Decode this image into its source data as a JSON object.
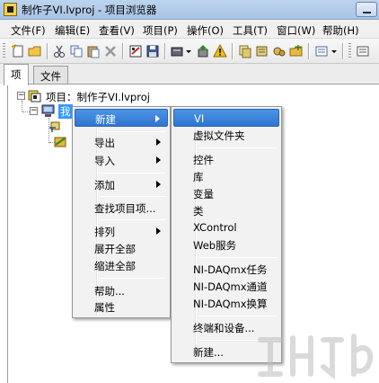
{
  "window": {
    "title": "制作子VI.lvproj - 项目浏览器"
  },
  "menubar": {
    "items": [
      "文件(F)",
      "编辑(E)",
      "查看(V)",
      "项目(P)",
      "操作(O)",
      "工具(T)",
      "窗口(W)",
      "帮助(H)"
    ]
  },
  "toolbar": {
    "icons": [
      "new-icon",
      "open-icon",
      "cut-icon",
      "copy-icon",
      "paste-icon",
      "delete-icon",
      "build-icon",
      "save-all-icon",
      "hardware-icon",
      "deploy-icon",
      "warning-icon",
      "project-files-icon",
      "items-icon",
      "dependencies-icon",
      "view-icon"
    ],
    "warning_color": "#f2c200"
  },
  "tabs": [
    {
      "label": "项",
      "active": true
    },
    {
      "label": "文件",
      "active": false
    }
  ],
  "tree": {
    "root_label": "项目：制作子VI.lvproj",
    "child_selected_label": "我",
    "root_expander": "−",
    "child_expander": "−"
  },
  "context_menu": {
    "items": [
      {
        "label": "新建",
        "has_submenu": true,
        "highlighted": true
      },
      {
        "label": "导出",
        "has_submenu": true
      },
      {
        "label": "导入",
        "has_submenu": true
      },
      {
        "label": "添加",
        "has_submenu": true
      },
      {
        "label": "查找项目项...",
        "has_submenu": false
      },
      {
        "label": "排列",
        "has_submenu": true
      },
      {
        "label": "展开全部",
        "has_submenu": false
      },
      {
        "label": "缩进全部",
        "has_submenu": false
      },
      {
        "label": "帮助...",
        "has_submenu": false
      },
      {
        "label": "属性",
        "has_submenu": false
      }
    ]
  },
  "submenu": {
    "items": [
      {
        "label": "VI",
        "highlighted": true
      },
      {
        "label": "虚拟文件夹"
      },
      {
        "label": "控件"
      },
      {
        "label": "库"
      },
      {
        "label": "变量"
      },
      {
        "label": "类"
      },
      {
        "label": "XControl"
      },
      {
        "label": "Web服务"
      },
      {
        "label": "NI-DAQmx任务"
      },
      {
        "label": "NI-DAQmx通道"
      },
      {
        "label": "NI-DAQmx换算"
      },
      {
        "label": "终端和设备..."
      },
      {
        "label": "新建..."
      }
    ]
  },
  "colors": {
    "highlight": "#3a82db",
    "selection": "#3399ff",
    "menu_bg": "#f2f2f2"
  }
}
